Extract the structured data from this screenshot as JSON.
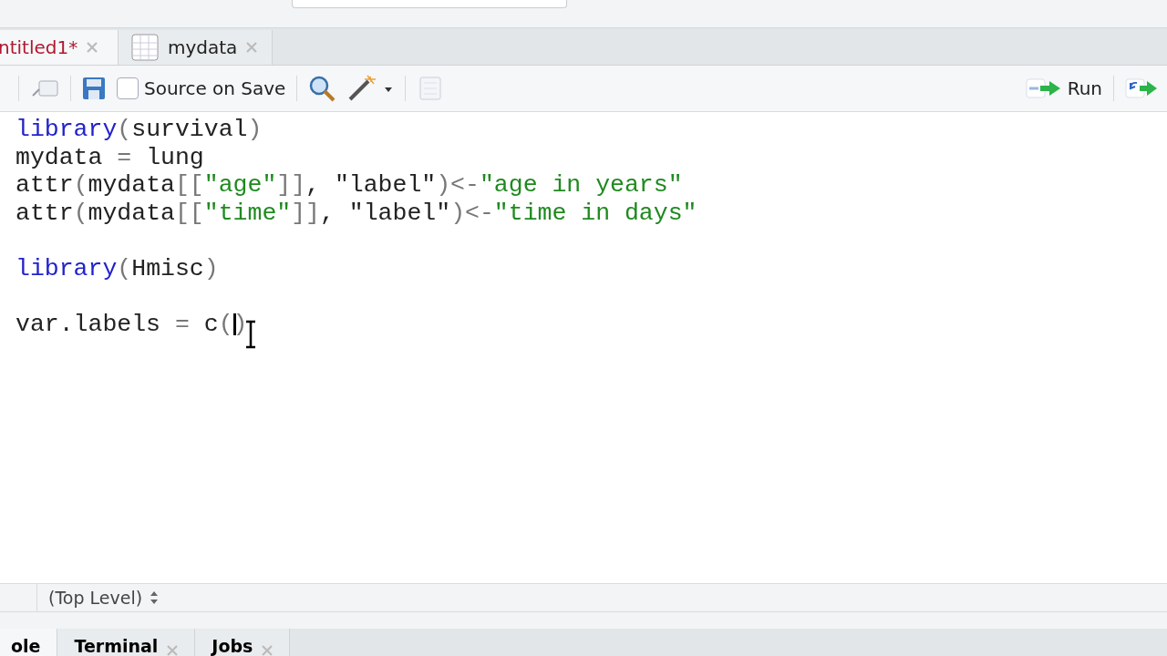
{
  "editor_tabs": [
    {
      "label": "ntitled1*",
      "selected": true,
      "modified": true,
      "kind": "script"
    },
    {
      "label": "mydata",
      "selected": false,
      "modified": false,
      "kind": "data"
    }
  ],
  "toolbar": {
    "source_on_save": {
      "label": "Source on Save",
      "checked": false
    },
    "run_button": "Run"
  },
  "code_lines": [
    {
      "kind": "code",
      "tokens": [
        {
          "kind": "function",
          "text": "library"
        },
        {
          "kind": "operator",
          "text": "("
        },
        {
          "kind": "plain",
          "text": "survival"
        },
        {
          "kind": "operator",
          "text": ")"
        }
      ]
    },
    {
      "kind": "code",
      "tokens": [
        {
          "kind": "plain",
          "text": "mydata"
        },
        {
          "kind": "operator",
          "text": " = "
        },
        {
          "kind": "plain",
          "text": "lung"
        }
      ]
    },
    {
      "kind": "code",
      "tokens": [
        {
          "kind": "plain",
          "text": "attr"
        },
        {
          "kind": "operator",
          "text": "("
        },
        {
          "kind": "plain",
          "text": "mydata"
        },
        {
          "kind": "operator",
          "text": "[["
        },
        {
          "kind": "string",
          "text": "\"age\""
        },
        {
          "kind": "operator",
          "text": "]]"
        },
        {
          "kind": "plain",
          "text": ", \"label\""
        },
        {
          "kind": "operator",
          "text": ")<-"
        },
        {
          "kind": "string",
          "text": "\"age in years\""
        }
      ]
    },
    {
      "kind": "code",
      "tokens": [
        {
          "kind": "plain",
          "text": "attr"
        },
        {
          "kind": "operator",
          "text": "("
        },
        {
          "kind": "plain",
          "text": "mydata"
        },
        {
          "kind": "operator",
          "text": "[["
        },
        {
          "kind": "string",
          "text": "\"time\""
        },
        {
          "kind": "operator",
          "text": "]]"
        },
        {
          "kind": "plain",
          "text": ", \"label\""
        },
        {
          "kind": "operator",
          "text": ")<-"
        },
        {
          "kind": "string",
          "text": "\"time in days\""
        }
      ]
    },
    {
      "kind": "blank"
    },
    {
      "kind": "code",
      "tokens": [
        {
          "kind": "function",
          "text": "library"
        },
        {
          "kind": "operator",
          "text": "("
        },
        {
          "kind": "plain",
          "text": "Hmisc"
        },
        {
          "kind": "operator",
          "text": ")"
        }
      ]
    },
    {
      "kind": "blank"
    },
    {
      "kind": "code",
      "tokens": [
        {
          "kind": "plain",
          "text": "var.labels"
        },
        {
          "kind": "operator",
          "text": " = "
        },
        {
          "kind": "plain",
          "text": "c"
        },
        {
          "kind": "operator",
          "text": "("
        },
        {
          "kind": "cursor"
        },
        {
          "kind": "operator",
          "text": ")"
        }
      ]
    }
  ],
  "status_bar": {
    "scope": "(Top Level)"
  },
  "panel_tabs": [
    {
      "label": "ole",
      "selected": true,
      "closable": false
    },
    {
      "label": "Terminal",
      "selected": false,
      "closable": true
    },
    {
      "label": "Jobs",
      "selected": false,
      "closable": true
    }
  ]
}
